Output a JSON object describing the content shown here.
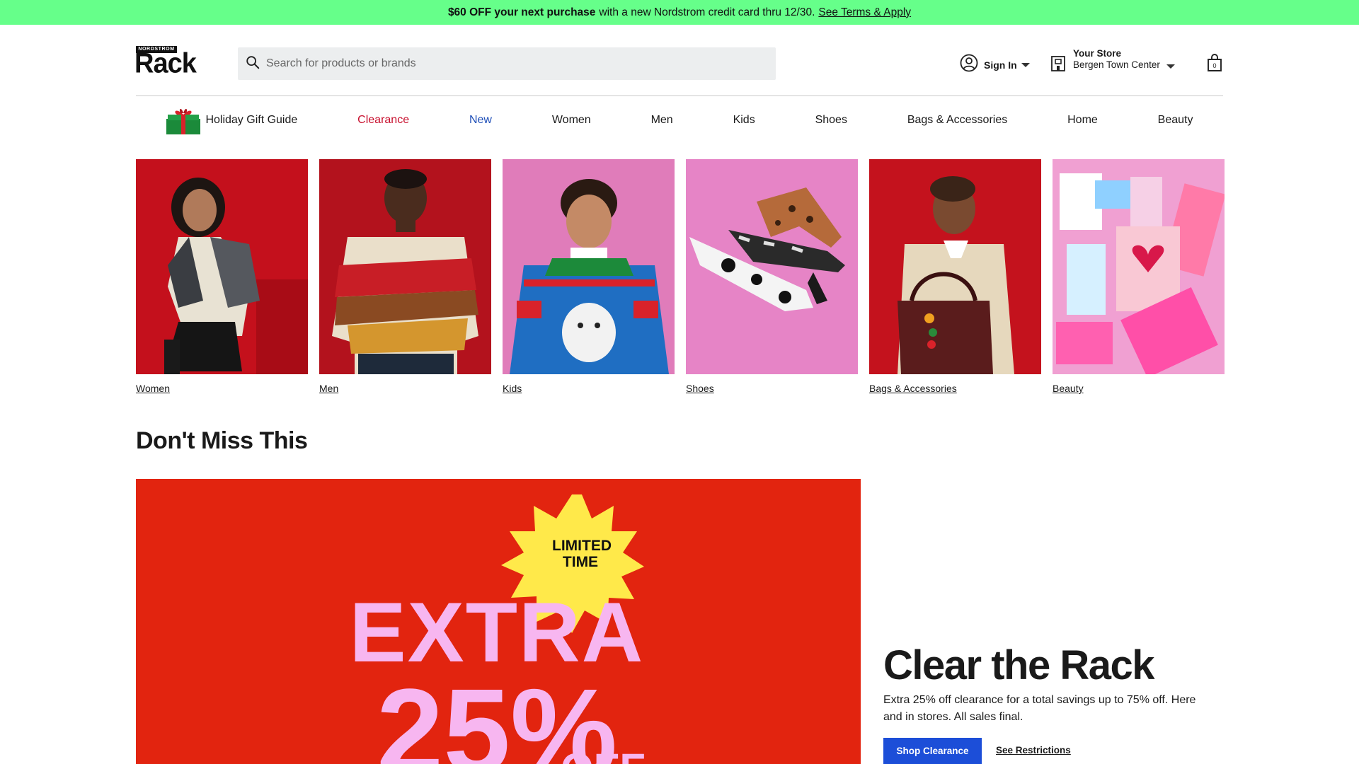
{
  "promo": {
    "bold": "$60 OFF your next purchase",
    "text": "with a new Nordstrom credit card thru 12/30.",
    "link": "See Terms & Apply",
    "background": "#66ff8a"
  },
  "header": {
    "logo_small": "NORDSTROM",
    "logo_big": "Rack",
    "search_placeholder": "Search for products or brands",
    "search_icon": "search-icon",
    "signin_label": "Sign In",
    "signin_icon": "user-icon",
    "store_label": "Your Store",
    "store_name": "Bergen Town Center",
    "store_icon": "store-icon",
    "bag_icon": "shopping-bag-icon"
  },
  "nav": {
    "items": [
      {
        "label": "Holiday Gift Guide",
        "color": "#1a1a1a"
      },
      {
        "label": "Clearance",
        "color": "#c8102e"
      },
      {
        "label": "New",
        "color": "#1f4fb8"
      },
      {
        "label": "Women",
        "color": "#1a1a1a"
      },
      {
        "label": "Men",
        "color": "#1a1a1a"
      },
      {
        "label": "Kids",
        "color": "#1a1a1a"
      },
      {
        "label": "Shoes",
        "color": "#1a1a1a"
      },
      {
        "label": "Bags & Accessories",
        "color": "#1a1a1a"
      },
      {
        "label": "Home",
        "color": "#1a1a1a"
      },
      {
        "label": "Beauty",
        "color": "#1a1a1a"
      }
    ]
  },
  "categories": [
    {
      "label": "Women"
    },
    {
      "label": "Men"
    },
    {
      "label": "Kids"
    },
    {
      "label": "Shoes"
    },
    {
      "label": "Bags & Accessories"
    },
    {
      "label": "Beauty"
    }
  ],
  "section": {
    "title": "Don't Miss This"
  },
  "hero": {
    "badge_line1": "LIMITED",
    "badge_line2": "TIME",
    "big_line1": "EXTRA",
    "big_line2": "25%",
    "big_line3": "OFF",
    "background": "#e2240f",
    "text_color": "#f7b6f0",
    "badge_color": "#ffe94a"
  },
  "promo_block": {
    "title": "Clear the Rack",
    "description": "Extra 25% off clearance for a total savings up to 75% off. Here and in stores. All sales final.",
    "shop_button": "Shop Clearance",
    "restrictions_link": "See Restrictions",
    "button_color": "#1c4ed8"
  }
}
